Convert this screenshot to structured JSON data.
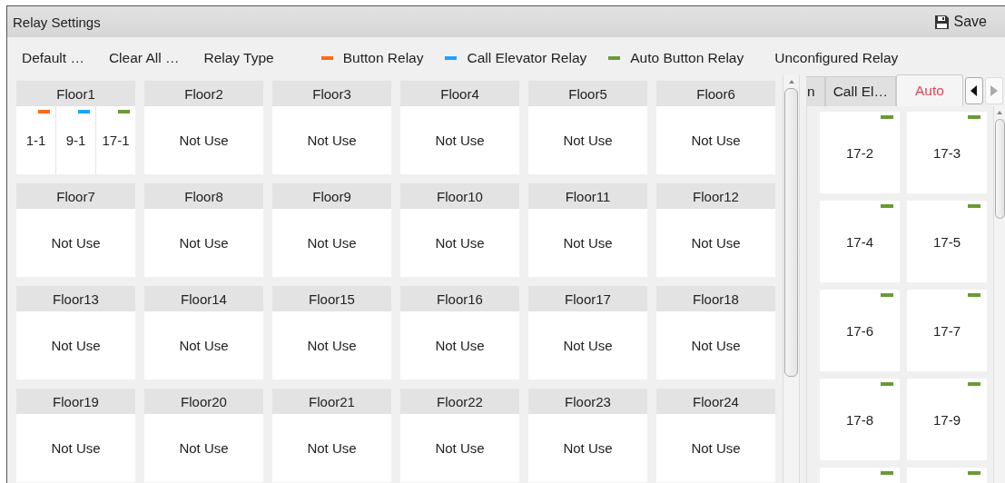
{
  "window": {
    "title": "Relay Settings"
  },
  "save_button": {
    "label": "Save"
  },
  "toolbar": {
    "buttons": [
      "Default …",
      "Clear All …"
    ],
    "relay_type_label": "Relay Type",
    "legend": [
      {
        "label": "Button Relay",
        "color": "#ff6a13"
      },
      {
        "label": "Call Elevator Relay",
        "color": "#1aa3ff"
      },
      {
        "label": "Auto Button Relay",
        "color": "#6a9a35"
      }
    ]
  },
  "floors": [
    {
      "name": "Floor1",
      "kind": "relays",
      "relays": [
        {
          "label": "1-1",
          "color": "#ff6a13"
        },
        {
          "label": "9-1",
          "color": "#1aa3ff"
        },
        {
          "label": "17-1",
          "color": "#6a9a35"
        }
      ]
    },
    {
      "name": "Floor2",
      "kind": "text",
      "value": "Not Use"
    },
    {
      "name": "Floor3",
      "kind": "text",
      "value": "Not Use"
    },
    {
      "name": "Floor4",
      "kind": "text",
      "value": "Not Use"
    },
    {
      "name": "Floor5",
      "kind": "text",
      "value": "Not Use"
    },
    {
      "name": "Floor6",
      "kind": "text",
      "value": "Not Use"
    },
    {
      "name": "Floor7",
      "kind": "text",
      "value": "Not Use"
    },
    {
      "name": "Floor8",
      "kind": "text",
      "value": "Not Use"
    },
    {
      "name": "Floor9",
      "kind": "text",
      "value": "Not Use"
    },
    {
      "name": "Floor10",
      "kind": "text",
      "value": "Not Use"
    },
    {
      "name": "Floor11",
      "kind": "text",
      "value": "Not Use"
    },
    {
      "name": "Floor12",
      "kind": "text",
      "value": "Not Use"
    },
    {
      "name": "Floor13",
      "kind": "text",
      "value": "Not Use"
    },
    {
      "name": "Floor14",
      "kind": "text",
      "value": "Not Use"
    },
    {
      "name": "Floor15",
      "kind": "text",
      "value": "Not Use"
    },
    {
      "name": "Floor16",
      "kind": "text",
      "value": "Not Use"
    },
    {
      "name": "Floor17",
      "kind": "text",
      "value": "Not Use"
    },
    {
      "name": "Floor18",
      "kind": "text",
      "value": "Not Use"
    },
    {
      "name": "Floor19",
      "kind": "text",
      "value": "Not Use"
    },
    {
      "name": "Floor20",
      "kind": "text",
      "value": "Not Use"
    },
    {
      "name": "Floor21",
      "kind": "text",
      "value": "Not Use"
    },
    {
      "name": "Floor22",
      "kind": "text",
      "value": "Not Use"
    },
    {
      "name": "Floor23",
      "kind": "text",
      "value": "Not Use"
    },
    {
      "name": "Floor24",
      "kind": "text",
      "value": "Not Use"
    }
  ],
  "unconfigured": {
    "title": "Unconfigured Relay",
    "tabs": [
      {
        "label": "n",
        "selected": false
      },
      {
        "label": "Call El…",
        "selected": false
      },
      {
        "label": "Auto",
        "selected": true
      }
    ],
    "tiles": [
      {
        "label": "17-2",
        "color": "#6a9a35"
      },
      {
        "label": "17-3",
        "color": "#6a9a35"
      },
      {
        "label": "17-4",
        "color": "#6a9a35"
      },
      {
        "label": "17-5",
        "color": "#6a9a35"
      },
      {
        "label": "17-6",
        "color": "#6a9a35"
      },
      {
        "label": "17-7",
        "color": "#6a9a35"
      },
      {
        "label": "17-8",
        "color": "#6a9a35"
      },
      {
        "label": "17-9",
        "color": "#6a9a35"
      },
      {
        "color": "#6a9a35"
      },
      {
        "color": "#6a9a35"
      }
    ]
  }
}
